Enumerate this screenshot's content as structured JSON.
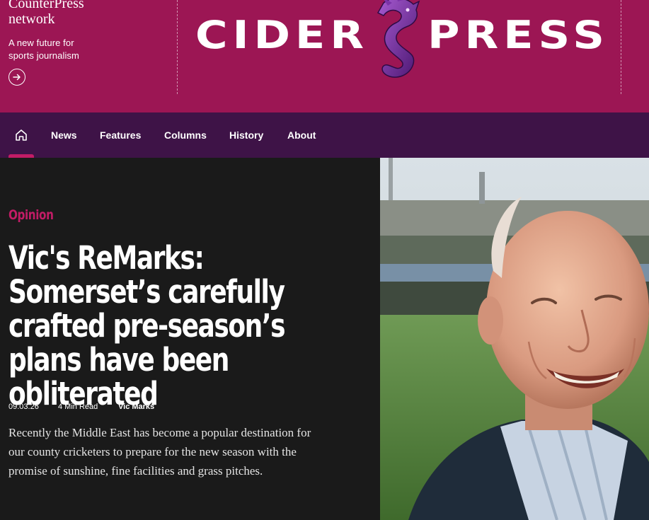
{
  "network": {
    "name": "CounterPress network",
    "tagline": "A new future for sports journalism"
  },
  "logo": {
    "left_word": "CIDER",
    "right_word": "PRESS"
  },
  "nav": {
    "items": [
      {
        "label": "News"
      },
      {
        "label": "Features"
      },
      {
        "label": "Columns"
      },
      {
        "label": "History"
      },
      {
        "label": "About"
      }
    ]
  },
  "article": {
    "category": "Opinion",
    "title": "Vic's ReMarks: Somerset’s carefully crafted pre-season’s plans have been obliterated",
    "date": "09.03.26",
    "read_time": "4 Min Read",
    "author": "Vic Marks",
    "excerpt": "Recently the Middle East has become a popular destination for our county cricketers to prepare for the new season with the promise of sunshine, fine facilities and grass pitches."
  },
  "colors": {
    "header_bg": "#9c1654",
    "nav_bg": "#3e1347",
    "accent": "#c21c66",
    "article_bg": "#1a1a1a"
  },
  "icons": {
    "network_link": "arrow-right-circle-icon",
    "home": "home-icon",
    "logo_mark": "dragon-icon"
  }
}
